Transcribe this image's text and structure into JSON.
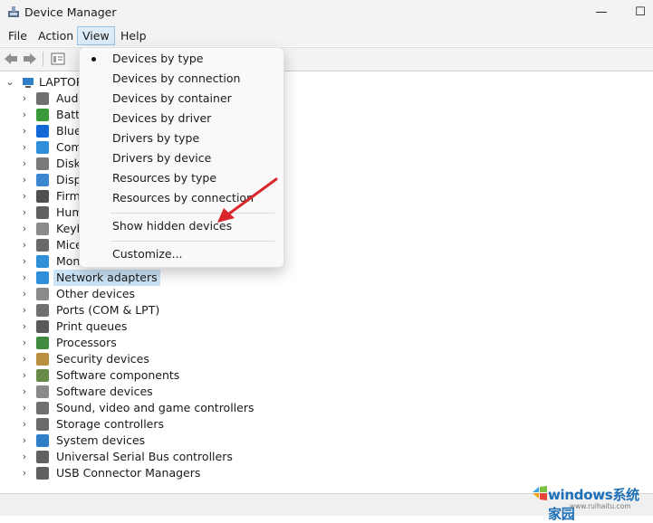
{
  "window": {
    "title": "Device Manager",
    "minimize": "—",
    "maximize": "☐"
  },
  "menubar": {
    "items": [
      "File",
      "Action",
      "View",
      "Help"
    ]
  },
  "tree": {
    "root": "LAPTOP",
    "categories": [
      {
        "label": "Aud",
        "color": "#707070"
      },
      {
        "label": "Batte",
        "color": "#3a9a3a"
      },
      {
        "label": "Blue",
        "color": "#1268d6"
      },
      {
        "label": "Com",
        "color": "#2f8fd8"
      },
      {
        "label": "Disk",
        "color": "#7a7a7a"
      },
      {
        "label": "Disp",
        "color": "#3c86d0"
      },
      {
        "label": "Firm",
        "color": "#505050"
      },
      {
        "label": "Hum",
        "color": "#606060"
      },
      {
        "label": "Keyb",
        "color": "#8a8a8a"
      },
      {
        "label": "Mice",
        "color": "#6a6a6a"
      },
      {
        "label": "Mon",
        "color": "#2f8fd8"
      },
      {
        "label": "Network adapters",
        "color": "#2f8fd8"
      },
      {
        "label": "Other devices",
        "color": "#8a8a8a"
      },
      {
        "label": "Ports (COM & LPT)",
        "color": "#707070"
      },
      {
        "label": "Print queues",
        "color": "#5a5a5a"
      },
      {
        "label": "Processors",
        "color": "#3f8a3f"
      },
      {
        "label": "Security devices",
        "color": "#b89040"
      },
      {
        "label": "Software components",
        "color": "#6a8a4a"
      },
      {
        "label": "Software devices",
        "color": "#8a8a8a"
      },
      {
        "label": "Sound, video and game controllers",
        "color": "#707070"
      },
      {
        "label": "Storage controllers",
        "color": "#6a6a6a"
      },
      {
        "label": "System devices",
        "color": "#2f7fc8"
      },
      {
        "label": "Universal Serial Bus controllers",
        "color": "#606060"
      },
      {
        "label": "USB Connector Managers",
        "color": "#606060"
      }
    ]
  },
  "view_menu": {
    "items": [
      "Devices by type",
      "Devices by connection",
      "Devices by container",
      "Devices by driver",
      "Drivers by type",
      "Drivers by device",
      "Resources by type",
      "Resources by connection",
      "Show hidden devices",
      "Customize..."
    ],
    "checked": "Devices by type"
  },
  "watermark": {
    "text": "windows系统家园",
    "sub": "www.ruihaitu.com"
  },
  "colors": {
    "arrow": "#d9262a",
    "selection": "#cce4f7",
    "menu_active": "#dcecf9"
  }
}
